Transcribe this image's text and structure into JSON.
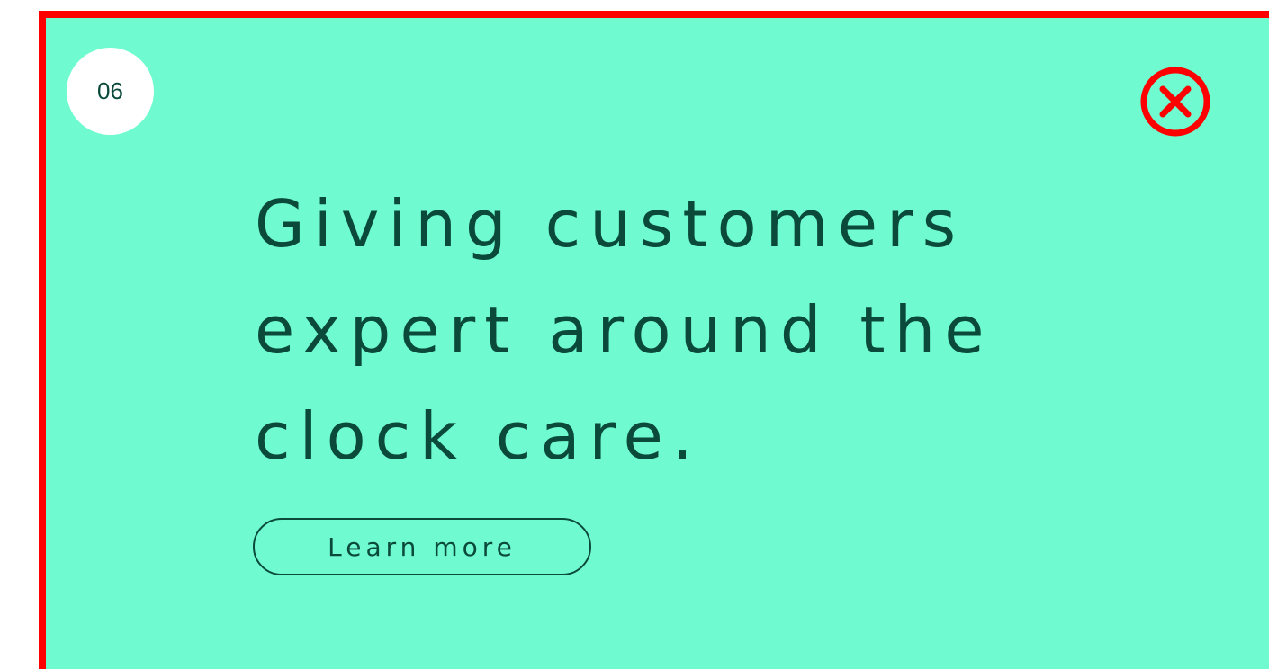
{
  "slide": {
    "step_number": "06",
    "headline": "Giving customers expert around the clock care.",
    "cta_label": "Learn more",
    "close_icon": "close-circle-icon"
  },
  "colors": {
    "background": "#6ffbcf",
    "text": "#0b4a3b",
    "highlight_border": "#ff0000",
    "close_icon": "#ff0000",
    "badge": "#ffffff"
  }
}
